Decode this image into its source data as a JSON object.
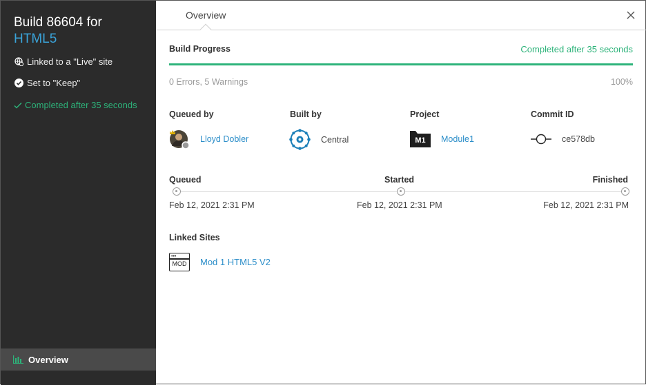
{
  "sidebar": {
    "title_line1": "Build 86604 for",
    "title_line2": "HTML5",
    "linked_text": "Linked to a \"Live\" site",
    "keep_text": "Set to \"Keep\"",
    "completed_text": "Completed after 35 seconds",
    "nav_overview": "Overview",
    "nav_icon": "bar-chart-icon"
  },
  "tabs": {
    "overview": "Overview"
  },
  "progress": {
    "label": "Build Progress",
    "status": "Completed after 35 seconds",
    "percent_value": 1.0,
    "errors": "0 Errors, 5 Warnings",
    "percent": "100%"
  },
  "info": {
    "queued_by_label": "Queued by",
    "queued_by_value": "Lloyd Dobler",
    "built_by_label": "Built by",
    "built_by_value": "Central",
    "project_label": "Project",
    "project_badge": "M1",
    "project_value": "Module1",
    "commit_label": "Commit ID",
    "commit_value": "ce578db"
  },
  "timeline": {
    "queued_label": "Queued",
    "started_label": "Started",
    "finished_label": "Finished",
    "queued_date": "Feb 12, 2021 2:31 PM",
    "started_date": "Feb 12, 2021 2:31 PM",
    "finished_date": "Feb 12, 2021 2:31 PM"
  },
  "linked_sites": {
    "label": "Linked Sites",
    "site_badge": "MOD",
    "site_name": "Mod 1 HTML5 V2"
  },
  "colors": {
    "accent_blue": "#3aa3d9",
    "success_green": "#2db37a",
    "sidebar_bg": "#2b2b2b"
  }
}
